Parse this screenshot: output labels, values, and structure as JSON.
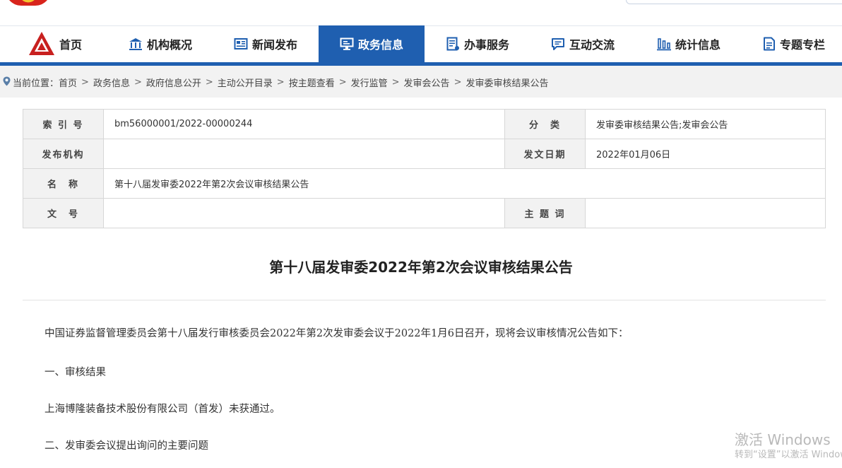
{
  "nav": {
    "items": [
      {
        "label": "首页",
        "icon": "home-logo-icon"
      },
      {
        "label": "机构概况",
        "icon": "building-icon"
      },
      {
        "label": "新闻发布",
        "icon": "newspaper-icon"
      },
      {
        "label": "政务信息",
        "icon": "monitor-icon",
        "active": true
      },
      {
        "label": "办事服务",
        "icon": "document-list-icon"
      },
      {
        "label": "互动交流",
        "icon": "chat-icon"
      },
      {
        "label": "统计信息",
        "icon": "bar-chart-icon"
      },
      {
        "label": "专题专栏",
        "icon": "file-icon"
      }
    ],
    "active_color": "#1f5fb0"
  },
  "breadcrumb": {
    "prefix": "当前位置：",
    "items": [
      "首页",
      "政务信息",
      "政府信息公开",
      "主动公开目录",
      "按主题查看",
      "发行监管",
      "发审会公告",
      "发审委审核结果公告"
    ]
  },
  "meta": {
    "index_label": "索 引 号",
    "index_value": "bm56000001/2022-00000244",
    "category_label": "分　类",
    "category_value": "发审委审核结果公告;发审会公告",
    "publisher_label": "发布机构",
    "publisher_value": "",
    "date_label": "发文日期",
    "date_value": "2022年01月06日",
    "name_label": "名　称",
    "name_value": "第十八届发审委2022年第2次会议审核结果公告",
    "docno_label": "文　号",
    "docno_value": "",
    "keywords_label": "主 题 词",
    "keywords_value": ""
  },
  "article": {
    "title": "第十八届发审委2022年第2次会议审核结果公告",
    "paragraphs": [
      "中国证券监督管理委员会第十八届发行审核委员会2022年第2次发审委会议于2022年1月6日召开，现将会议审核情况公告如下：",
      "一、审核结果",
      "上海博隆装备技术股份有限公司（首发）未获通过。",
      "二、发审委会议提出询问的主要问题"
    ]
  },
  "watermark": {
    "line1": "激活 Windows",
    "line2": "转到“设置”以激活 Windows。"
  }
}
